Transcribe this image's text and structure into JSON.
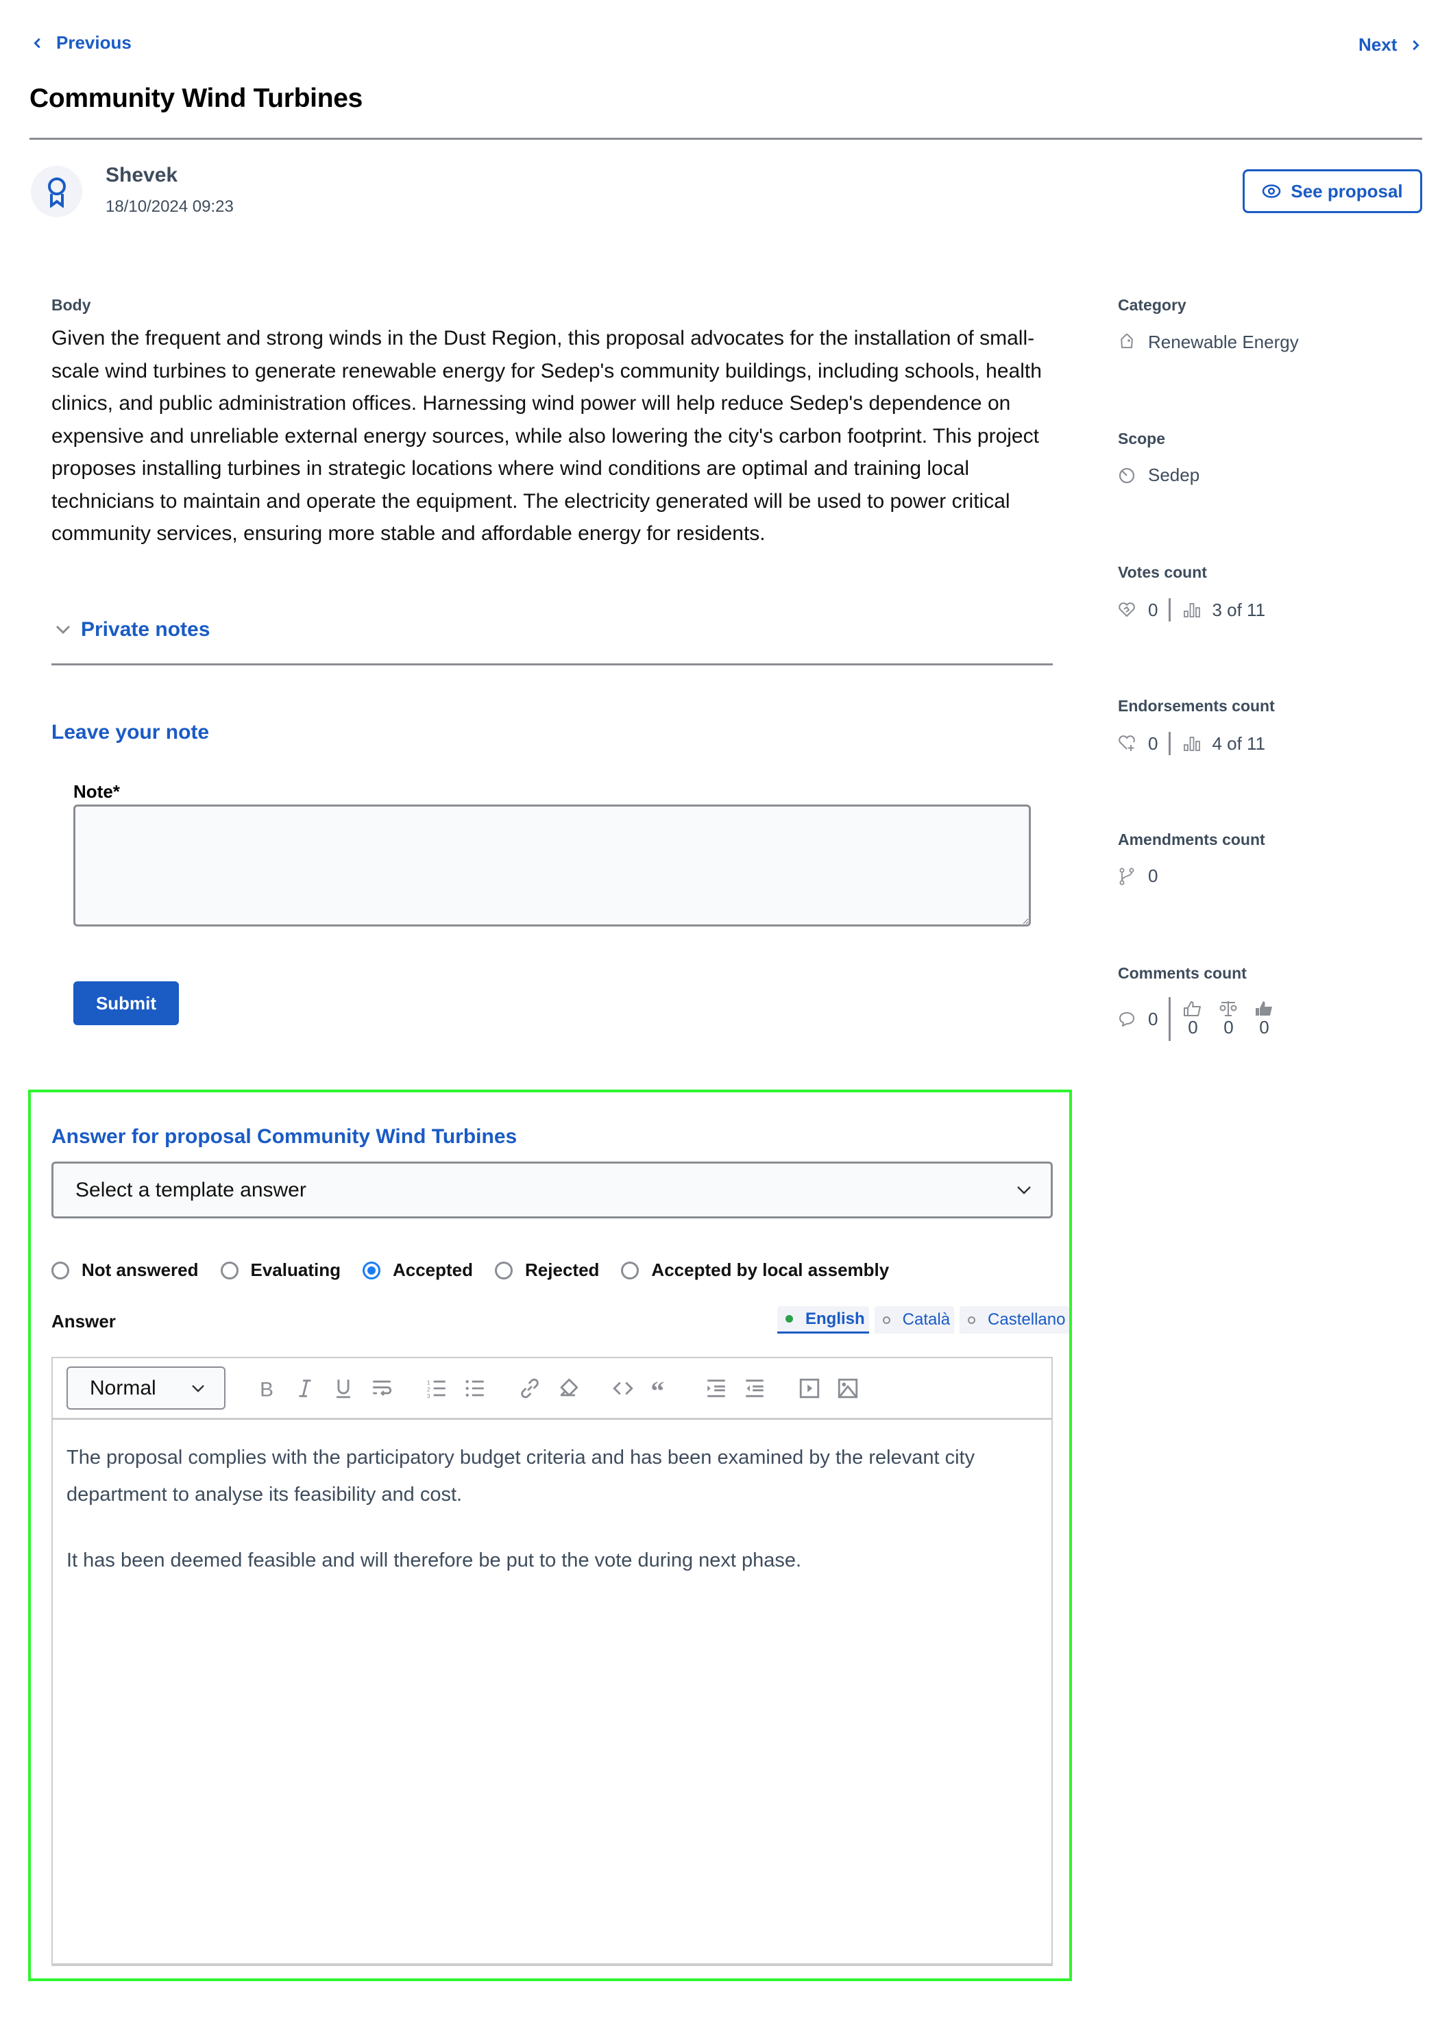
{
  "nav": {
    "previous_label": "Previous",
    "next_label": "Next"
  },
  "proposal": {
    "title": "Community Wind Turbines",
    "author": "Shevek",
    "date": "18/10/2024 09:23",
    "see_proposal_label": "See proposal",
    "body_label": "Body",
    "body": "Given the frequent and strong winds in the Dust Region, this proposal advocates for the installation of small-scale wind turbines to generate renewable energy for Sedep's community buildings, including schools, health clinics, and public administration offices. Harnessing wind power will help reduce Sedep's dependence on expensive and unreliable external energy sources, while also lowering the city's carbon footprint. This project proposes installing turbines in strategic locations where wind conditions are optimal and training local technicians to maintain and operate the equipment. The electricity generated will be used to power critical community services, ensuring more stable and affordable energy for residents."
  },
  "private_notes": {
    "toggle_label": "Private notes",
    "leave_note_heading": "Leave your note",
    "note_label": "Note*",
    "note_value": "",
    "submit_label": "Submit"
  },
  "sidebar": {
    "category": {
      "label": "Category",
      "value": "Renewable Energy",
      "icon": "tag-icon"
    },
    "scope": {
      "label": "Scope",
      "value": "Sedep",
      "icon": "scope-icon"
    },
    "votes": {
      "label": "Votes count",
      "count": "0",
      "ranking": "3 of 11"
    },
    "endorsements": {
      "label": "Endorsements count",
      "count": "0",
      "ranking": "4 of 11"
    },
    "amendments": {
      "label": "Amendments count",
      "count": "0"
    },
    "comments": {
      "label": "Comments count",
      "count": "0",
      "in_favor": "0",
      "neutral": "0",
      "against": "0"
    }
  },
  "answer": {
    "heading": "Answer for proposal Community Wind Turbines",
    "template_select": "Select a template answer",
    "statuses": [
      {
        "label": "Not answered",
        "checked": false
      },
      {
        "label": "Evaluating",
        "checked": false
      },
      {
        "label": "Accepted",
        "checked": true
      },
      {
        "label": "Rejected",
        "checked": false
      },
      {
        "label": "Accepted by local assembly",
        "checked": false
      }
    ],
    "answer_label": "Answer",
    "languages": [
      {
        "label": "English",
        "active": true
      },
      {
        "label": "Català",
        "active": false
      },
      {
        "label": "Castellano",
        "active": false
      }
    ],
    "editor": {
      "heading_format": "Normal",
      "toolbar": [
        "bold",
        "italic",
        "underline",
        "hard-break",
        "ordered-list",
        "bullet-list",
        "link",
        "clear-formatting",
        "code",
        "blockquote",
        "indent",
        "outdent",
        "video",
        "image"
      ],
      "paragraphs": [
        "The proposal complies with the participatory budget criteria and has been examined by the relevant city department to analyse its feasibility and cost.",
        "It has been deemed feasible and will therefore be put to the vote during next phase."
      ]
    }
  },
  "colors": {
    "accent": "#1a5bc4",
    "radio_checked": "#1a7cf5",
    "active_lang_dot": "#2aa14a",
    "highlight_outline": "#2ef52e"
  }
}
